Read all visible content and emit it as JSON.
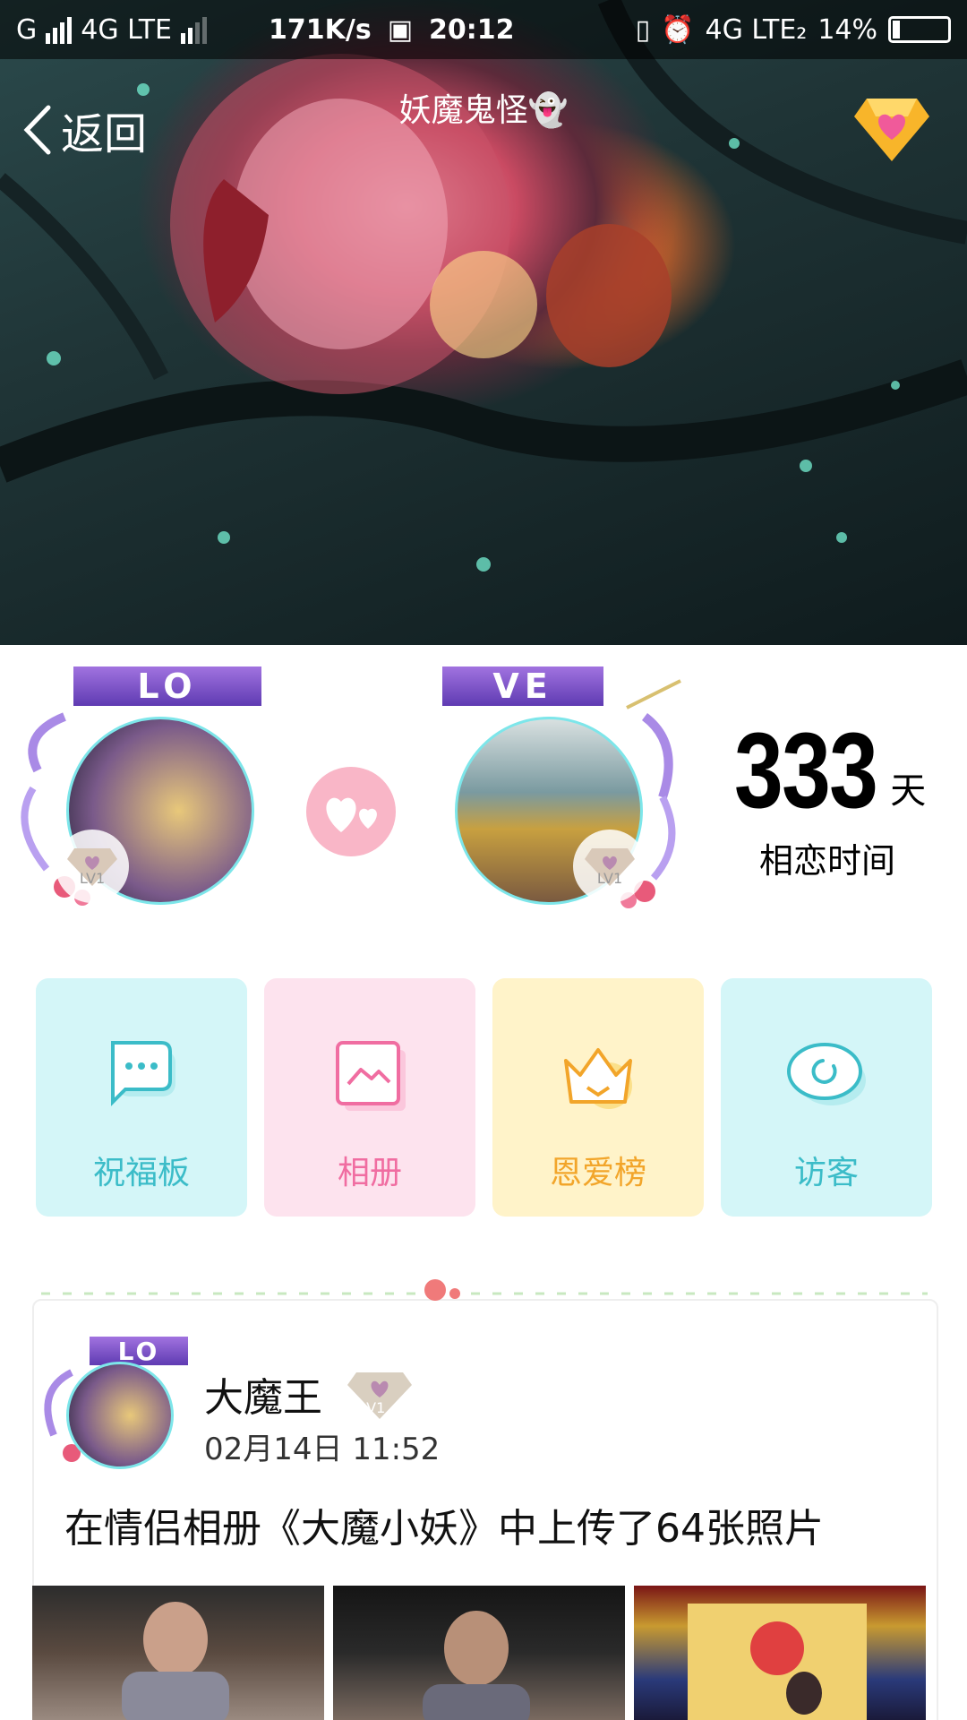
{
  "status_bar": {
    "carrier_left": "G",
    "network1": "4G LTE",
    "speed": "171K/s",
    "time": "20:12",
    "network2": "4G LTE₂",
    "battery": "14%"
  },
  "header": {
    "back_label": "返回",
    "title": "妖魔鬼怪👻"
  },
  "profile": {
    "ribbon_left": "LO",
    "ribbon_right": "VE",
    "level_left": "LV1",
    "level_right": "LV1",
    "days": "333",
    "days_unit": "天",
    "days_label": "相恋时间"
  },
  "features": [
    {
      "label": "祝福板",
      "icon": "chat-bubble-icon"
    },
    {
      "label": "相册",
      "icon": "photo-album-icon"
    },
    {
      "label": "恩爱榜",
      "icon": "crown-icon"
    },
    {
      "label": "访客",
      "icon": "eye-icon"
    }
  ],
  "feed": {
    "ribbon": "LO",
    "user_name": "大魔王",
    "level": "LV1",
    "time": "02月14日 11:52",
    "text": "在情侣相册《大魔小妖》中上传了64张照片"
  },
  "colors": {
    "accent_cyan": "#3bbcc8",
    "accent_pink": "#f06da1",
    "accent_yellow": "#f2a52a"
  }
}
